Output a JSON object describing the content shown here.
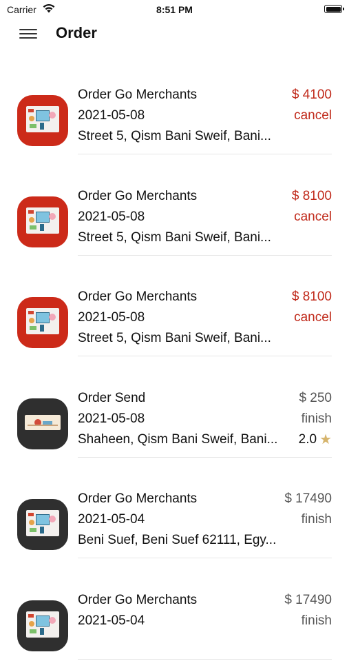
{
  "status_bar": {
    "carrier": "Carrier",
    "time": "8:51 PM"
  },
  "nav": {
    "title": "Order"
  },
  "orders": [
    {
      "title": "Order Go Merchants",
      "date": "2021-05-08",
      "address": "Street 5, Qism Bani Sweif, Bani...",
      "price": "$ 4100",
      "status": "cancel",
      "accent": "red",
      "rating": ""
    },
    {
      "title": "Order Go Merchants",
      "date": "2021-05-08",
      "address": "Street 5, Qism Bani Sweif, Bani...",
      "price": "$ 8100",
      "status": "cancel",
      "accent": "red",
      "rating": ""
    },
    {
      "title": "Order Go Merchants",
      "date": "2021-05-08",
      "address": "Street 5, Qism Bani Sweif, Bani...",
      "price": "$ 8100",
      "status": "cancel",
      "accent": "red",
      "rating": ""
    },
    {
      "title": "Order Send",
      "date": "2021-05-08",
      "address": "Shaheen, Qism Bani Sweif, Bani...",
      "price": "$ 250",
      "status": "finish",
      "accent": "dark",
      "rating": "2.0"
    },
    {
      "title": "Order Go Merchants",
      "date": "2021-05-04",
      "address": " Beni Suef, Beni Suef 62111, Egy...",
      "price": "$ 17490",
      "status": "finish",
      "accent": "dark",
      "rating": ""
    },
    {
      "title": "Order Go Merchants",
      "date": "2021-05-04",
      "address": "",
      "price": "$ 17490",
      "status": "finish",
      "accent": "dark",
      "rating": ""
    }
  ],
  "colors": {
    "cancel": "#c0291a",
    "finish": "#555555",
    "star": "#d6b46c"
  },
  "icons": {
    "menu": "hamburger-icon",
    "star": "star-icon",
    "wifi": "wifi-icon",
    "battery": "battery-icon"
  }
}
